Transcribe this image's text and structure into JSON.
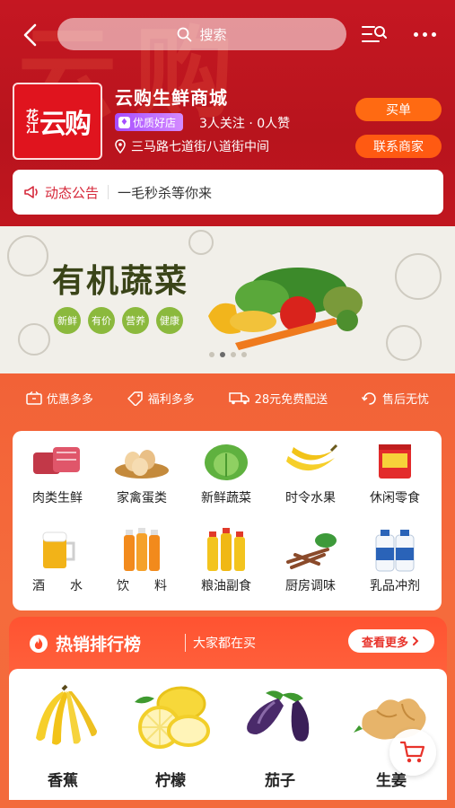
{
  "header": {
    "search_placeholder": "搜索",
    "shop": {
      "logo_text_small": "花江",
      "logo_text_big": "云购",
      "name": "云购生鲜商城",
      "badge": "优质好店",
      "follows": "3人关注 · 0人赞",
      "address": "三马路七道街八道街中间"
    },
    "buy_label": "买单",
    "contact_label": "联系商家",
    "notice_tag": "动态公告",
    "notice_text": "一毛秒杀等你来"
  },
  "banner": {
    "title": "有机蔬菜",
    "pills": [
      "新鲜",
      "有价",
      "营养",
      "健康"
    ],
    "slide_count": 4,
    "active_slide": 1
  },
  "perks": [
    "优惠多多",
    "福利多多",
    "28元免费配送",
    "售后无忧"
  ],
  "categories": [
    {
      "label": "肉类生鲜",
      "icon": "meat-icon"
    },
    {
      "label": "家禽蛋类",
      "icon": "eggs-icon"
    },
    {
      "label": "新鲜蔬菜",
      "icon": "cabbage-icon"
    },
    {
      "label": "时令水果",
      "icon": "banana-icon"
    },
    {
      "label": "休闲零食",
      "icon": "snack-icon"
    },
    {
      "label": "酒　　水",
      "icon": "beer-icon"
    },
    {
      "label": "饮　　料",
      "icon": "juice-icon"
    },
    {
      "label": "粮油副食",
      "icon": "oil-icon"
    },
    {
      "label": "厨房调味",
      "icon": "spice-icon"
    },
    {
      "label": "乳品冲剂",
      "icon": "milk-icon"
    }
  ],
  "hot": {
    "title": "热销排行榜",
    "subtitle": "大家都在买",
    "more_label": "查看更多",
    "products": [
      {
        "label": "香蕉",
        "icon": "banana-icon"
      },
      {
        "label": "柠檬",
        "icon": "lemon-icon"
      },
      {
        "label": "茄子",
        "icon": "eggplant-icon"
      },
      {
        "label": "生姜",
        "icon": "ginger-icon"
      }
    ]
  },
  "colors": {
    "brand_red": "#c51722",
    "accent_orange": "#ff6a12",
    "section_orange": "#f26237"
  }
}
